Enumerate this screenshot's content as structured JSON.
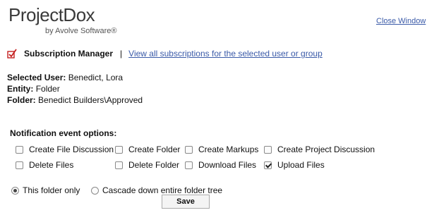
{
  "logo": {
    "brand": "ProjectDox",
    "tagline": "by Avolve Software®"
  },
  "header": {
    "close_label": "Close Window"
  },
  "subscription": {
    "title": "Subscription Manager",
    "separator": "|",
    "view_all_link": "View all subscriptions for the selected user or group"
  },
  "info": {
    "user_label": "Selected User:",
    "user_value": "Benedict, Lora",
    "entity_label": "Entity:",
    "entity_value": "Folder",
    "folder_label": "Folder:",
    "folder_value": "Benedict Builders\\Approved"
  },
  "notifications": {
    "heading": "Notification event options:",
    "options": [
      {
        "label": "Create File Discussion",
        "checked": false
      },
      {
        "label": "Create Folder",
        "checked": false
      },
      {
        "label": "Create Markups",
        "checked": false
      },
      {
        "label": "Create Project Discussion",
        "checked": false
      },
      {
        "label": "Delete Files",
        "checked": false
      },
      {
        "label": "Delete Folder",
        "checked": false
      },
      {
        "label": "Download Files",
        "checked": false
      },
      {
        "label": "Upload Files",
        "checked": true
      }
    ]
  },
  "scope": {
    "this_folder_label": "This folder only",
    "this_folder_selected": true,
    "cascade_label": "Cascade down entire folder tree",
    "cascade_selected": false
  },
  "save_label": "Save",
  "colors": {
    "link": "#3a5aa8",
    "icon_red": "#c42020"
  }
}
